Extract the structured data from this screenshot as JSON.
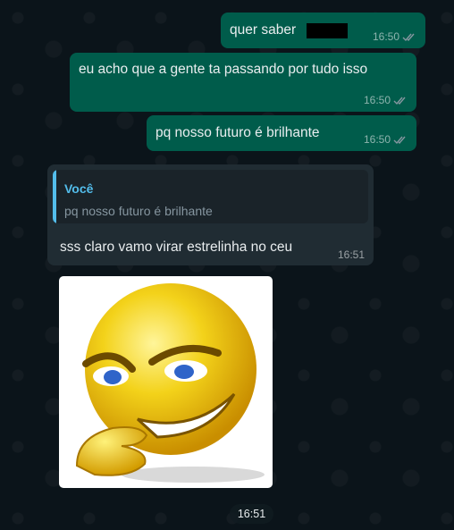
{
  "messages": [
    {
      "text": "quer saber",
      "time": "16:50",
      "status": "read",
      "direction": "outgoing",
      "redacted": true
    },
    {
      "text": "eu acho que a gente ta passando por tudo isso",
      "time": "16:50",
      "status": "read",
      "direction": "outgoing"
    },
    {
      "text": "pq nosso futuro é brilhante",
      "time": "16:50",
      "status": "read",
      "direction": "outgoing"
    },
    {
      "reply_to": {
        "author": "Você",
        "text": "pq nosso futuro é brilhante"
      },
      "text": "sss claro vamo virar estrelinha no ceu",
      "time": "16:51",
      "direction": "incoming"
    },
    {
      "type": "sticker",
      "description": "yellow smiley emoji with angry eyebrows and sly grin, hand on chin",
      "time": "16:51",
      "direction": "incoming"
    }
  ],
  "colors": {
    "background": "#0b141a",
    "outgoing_bubble": "#005c4b",
    "incoming_bubble": "#202c33",
    "reply_accent": "#53bdeb",
    "read_ticks": "#8696a0"
  },
  "icons": {
    "read_receipt": "double-check-icon"
  }
}
